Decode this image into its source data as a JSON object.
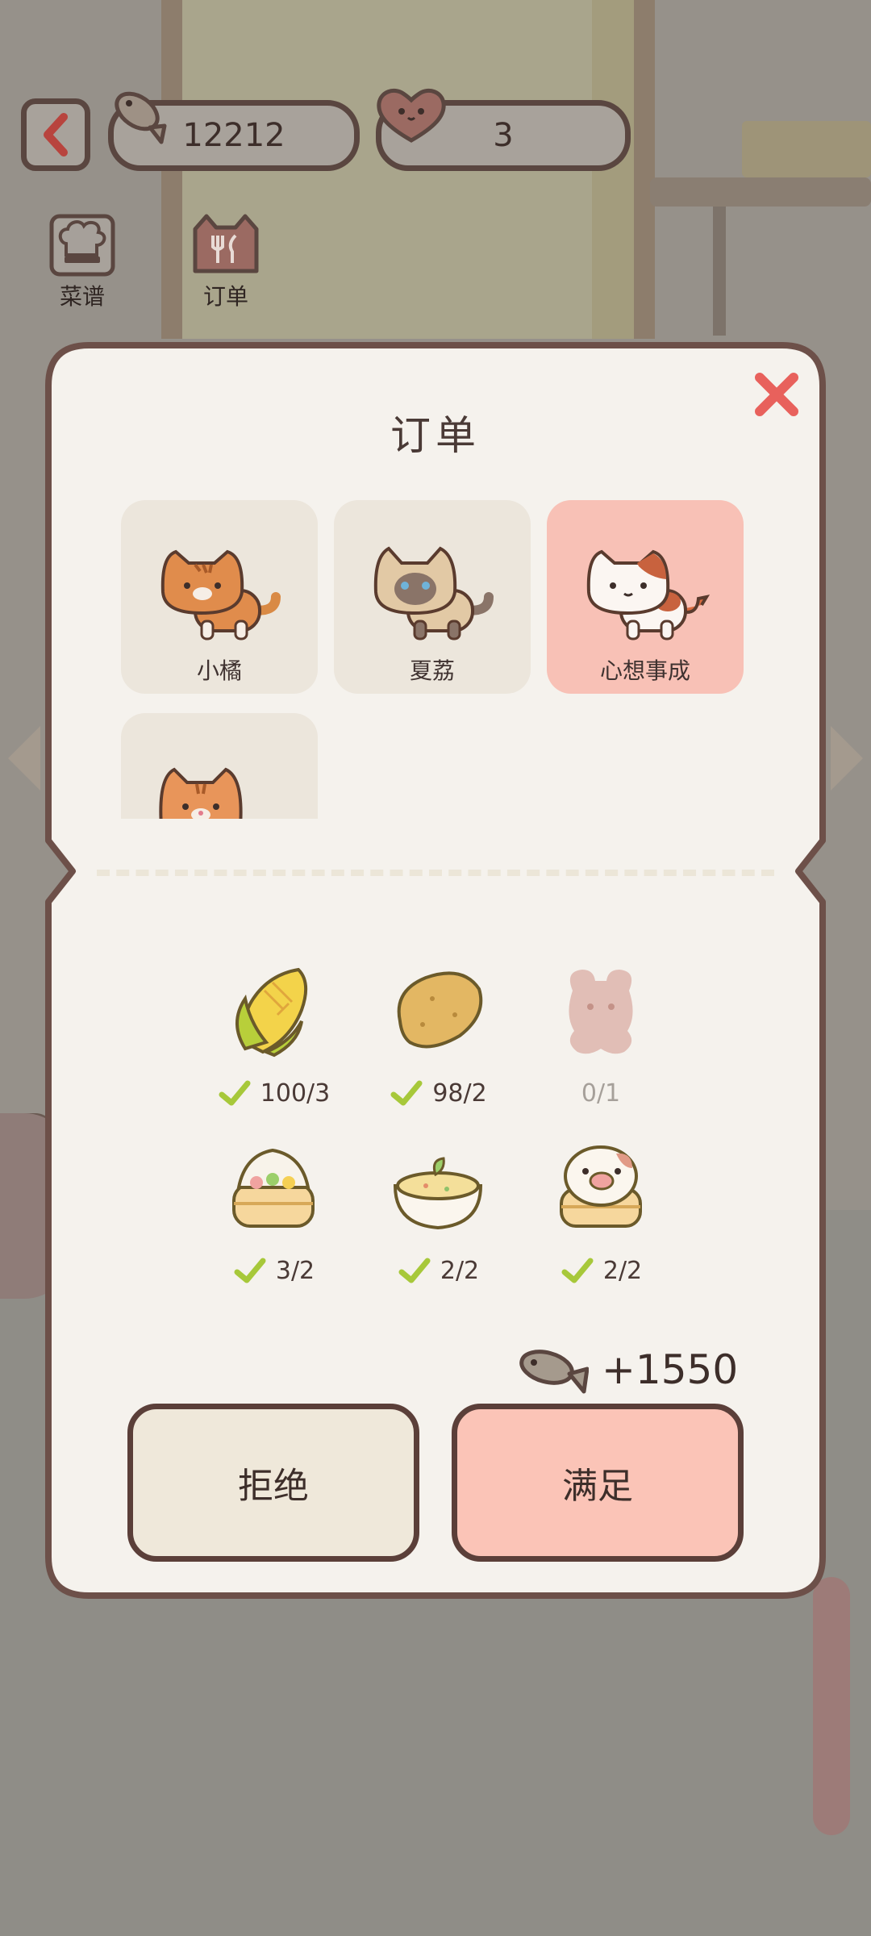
{
  "hud": {
    "fish_count": "12212",
    "heart_count": "3",
    "back_icon": "chevron-left-icon"
  },
  "tools": [
    {
      "label": "菜谱",
      "icon": "chef-hat-icon"
    },
    {
      "label": "订单",
      "icon": "cat-cutlery-icon"
    }
  ],
  "dialog": {
    "title": "订单",
    "close_icon": "close-icon",
    "cats": [
      {
        "name": "小橘",
        "selected": false
      },
      {
        "name": "夏荔",
        "selected": false
      },
      {
        "name": "心想事成",
        "selected": true
      },
      {
        "name": "",
        "selected": false
      }
    ],
    "ingredients": [
      {
        "icon": "corn-icon",
        "count": "100/3",
        "satisfied": true
      },
      {
        "icon": "potato-icon",
        "count": "98/2",
        "satisfied": true
      },
      {
        "icon": "bear-gummy-icon",
        "count": "0/1",
        "satisfied": false
      },
      {
        "icon": "steamed-bun-icon",
        "count": "3/2",
        "satisfied": true
      },
      {
        "icon": "egg-custard-bowl-icon",
        "count": "2/2",
        "satisfied": true
      },
      {
        "icon": "pig-bun-icon",
        "count": "2/2",
        "satisfied": true
      }
    ],
    "reward": {
      "icon": "fish-icon",
      "amount": "+1550"
    },
    "reject_label": "拒绝",
    "accept_label": "满足"
  },
  "colors": {
    "accent_pink": "#fbc4b7",
    "border_brown": "#5b3f39",
    "panel": "#f5f2ed",
    "check_green": "#a7c83a",
    "close_red": "#e8615c"
  }
}
